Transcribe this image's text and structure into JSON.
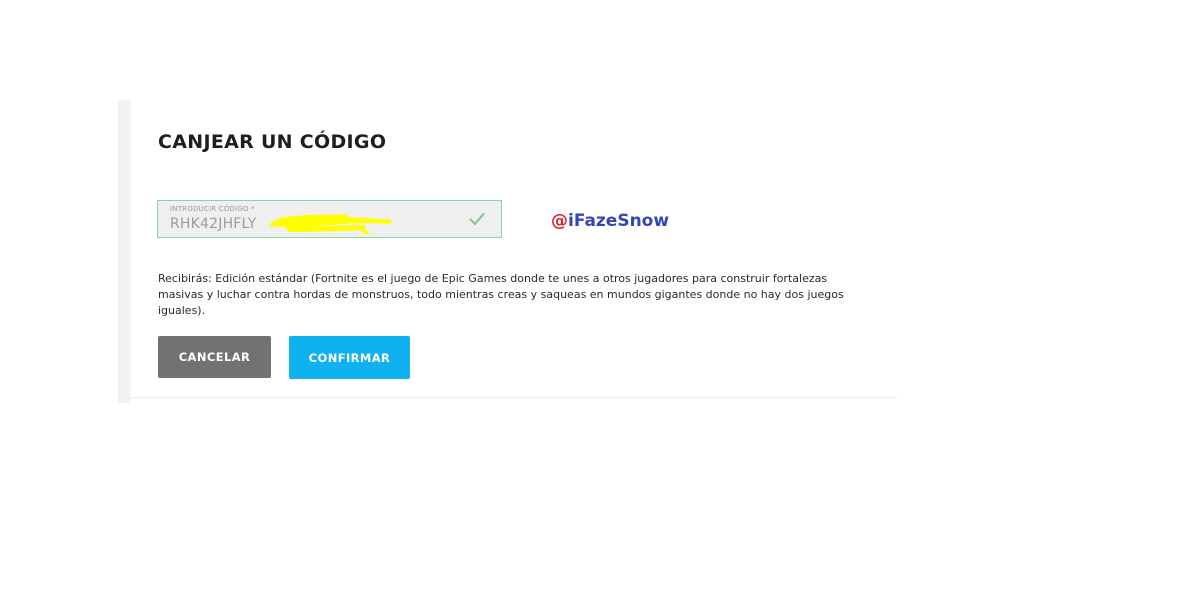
{
  "dialog": {
    "title": "CANJEAR UN CÓDIGO",
    "code_field": {
      "label": "INTRODUCIR CÓDIGO *",
      "value": "RHK42JHFLY",
      "valid_icon": "check-icon"
    },
    "description": "Recibirás: Edición estándar (Fortnite es el juego de Epic Games donde te unes a otros jugadores para construir fortalezas masivas y luchar contra hordas de monstruos, todo mientras creas y saqueas en mundos gigantes donde no hay dos juegos iguales).",
    "buttons": {
      "cancel_label": "CANCELAR",
      "confirm_label": "CONFIRMAR"
    }
  },
  "watermark": {
    "at": "@",
    "handle": "iFazeSnow"
  },
  "colors": {
    "confirm": "#0fb1f0",
    "cancel": "#727272",
    "valid_border": "#8fd19a",
    "redaction": "#ffff00",
    "watermark_at": "#e0202a",
    "watermark_handle": "#3346b8"
  }
}
